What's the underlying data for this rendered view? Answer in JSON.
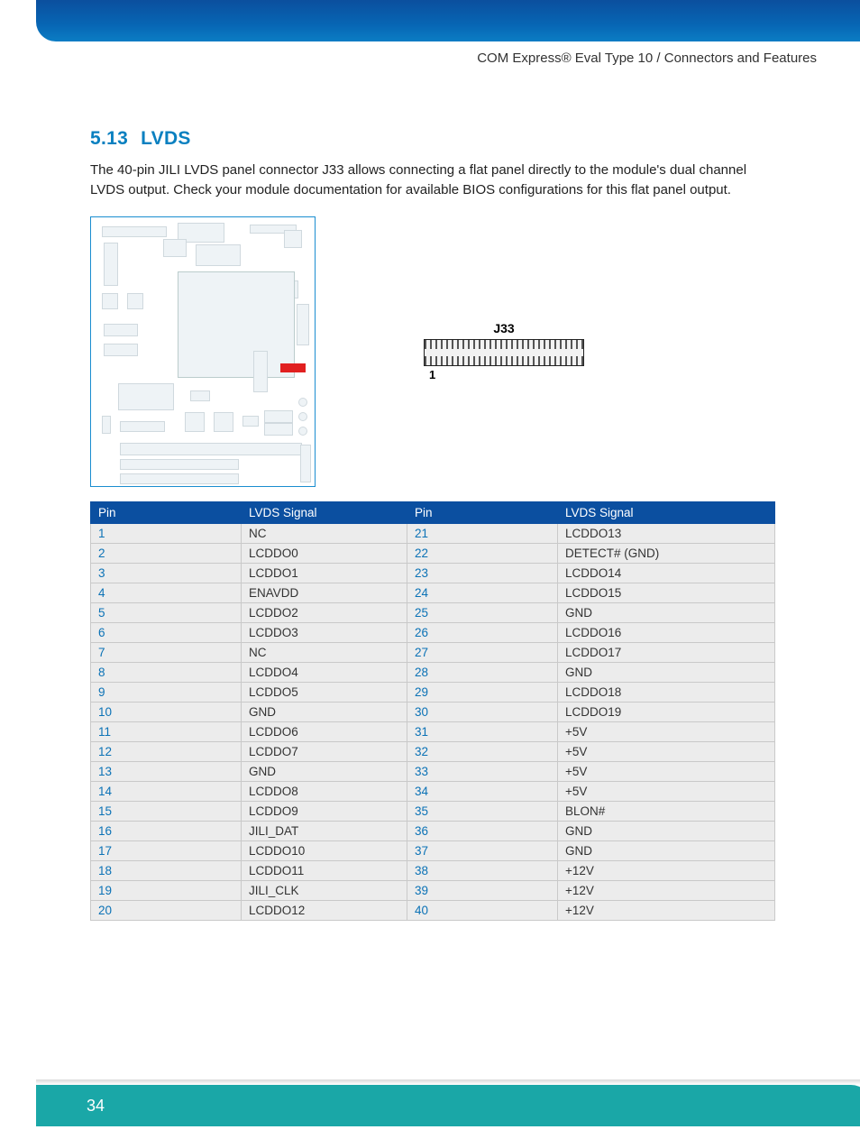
{
  "header": {
    "breadcrumb": "COM Express® Eval Type 10 / Connectors and Features"
  },
  "section": {
    "number": "5.13",
    "title": "LVDS",
    "paragraph": "The 40-pin JILI LVDS panel connector J33 allows connecting a flat panel directly to the module's dual channel LVDS output. Check your module documentation for available BIOS configurations for this flat panel output."
  },
  "connector": {
    "label": "J33",
    "pin1": "1"
  },
  "table": {
    "headers": [
      "Pin",
      "LVDS Signal",
      "Pin",
      "LVDS Signal"
    ],
    "rows": [
      {
        "p1": "1",
        "s1": "NC",
        "p2": "21",
        "s2": "LCDDO13"
      },
      {
        "p1": "2",
        "s1": "LCDDO0",
        "p2": "22",
        "s2": "DETECT# (GND)"
      },
      {
        "p1": "3",
        "s1": "LCDDO1",
        "p2": "23",
        "s2": "LCDDO14"
      },
      {
        "p1": "4",
        "s1": "ENAVDD",
        "p2": "24",
        "s2": "LCDDO15"
      },
      {
        "p1": "5",
        "s1": "LCDDO2",
        "p2": "25",
        "s2": "GND"
      },
      {
        "p1": "6",
        "s1": "LCDDO3",
        "p2": "26",
        "s2": "LCDDO16"
      },
      {
        "p1": "7",
        "s1": "NC",
        "p2": "27",
        "s2": "LCDDO17"
      },
      {
        "p1": "8",
        "s1": "LCDDO4",
        "p2": "28",
        "s2": "GND"
      },
      {
        "p1": "9",
        "s1": "LCDDO5",
        "p2": "29",
        "s2": "LCDDO18"
      },
      {
        "p1": "10",
        "s1": "GND",
        "p2": "30",
        "s2": "LCDDO19"
      },
      {
        "p1": "11",
        "s1": "LCDDO6",
        "p2": "31",
        "s2": "+5V"
      },
      {
        "p1": "12",
        "s1": "LCDDO7",
        "p2": "32",
        "s2": "+5V"
      },
      {
        "p1": "13",
        "s1": "GND",
        "p2": "33",
        "s2": "+5V"
      },
      {
        "p1": "14",
        "s1": "LCDDO8",
        "p2": "34",
        "s2": "+5V"
      },
      {
        "p1": "15",
        "s1": "LCDDO9",
        "p2": "35",
        "s2": "BLON#"
      },
      {
        "p1": "16",
        "s1": "JILI_DAT",
        "p2": "36",
        "s2": "GND"
      },
      {
        "p1": "17",
        "s1": "LCDDO10",
        "p2": "37",
        "s2": "GND"
      },
      {
        "p1": "18",
        "s1": "LCDDO11",
        "p2": "38",
        "s2": "+12V"
      },
      {
        "p1": "19",
        "s1": "JILI_CLK",
        "p2": "39",
        "s2": "+12V"
      },
      {
        "p1": "20",
        "s1": "LCDDO12",
        "p2": "40",
        "s2": "+12V"
      }
    ]
  },
  "footer": {
    "page": "34"
  }
}
